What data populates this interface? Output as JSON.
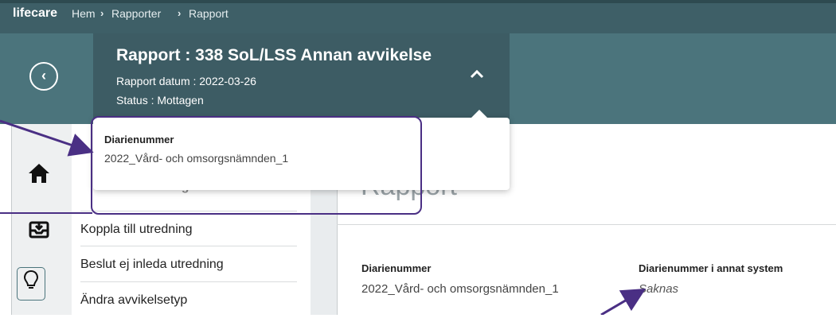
{
  "topbar": {
    "brand": "lifecare",
    "breadcrumb": [
      "Hem",
      "Rapporter",
      "Rapport"
    ],
    "separator": "›"
  },
  "header": {
    "title": "Rapport : 338 SoL/LSS Annan avvikelse",
    "date": "Rapport datum : 2022-03-26",
    "status": "Status : Mottagen",
    "back_icon": "chevron-left-icon",
    "collapse_icon": "chevron-up-icon"
  },
  "popup": {
    "label": "Diarienummer",
    "value": "2022_Vård- och omsorgsnämnden_1"
  },
  "sidebar": {
    "icons": [
      "home-icon",
      "inbox-icon",
      "lightbulb-icon"
    ]
  },
  "menu": {
    "items": [
      "Inled utredning",
      "Koppla till utredning",
      "Beslut ej inleda utredning",
      "Ändra avvikelsetyp"
    ]
  },
  "main": {
    "page_title": "Rapport",
    "fields": [
      {
        "label": "Diarienummer",
        "value": "2022_Vård- och omsorgsnämnden_1"
      },
      {
        "label": "Diarienummer i annat system",
        "value": "Saknas"
      }
    ]
  },
  "colors": {
    "topbar": "#3e5f67",
    "header": "#4b747c",
    "card": "#3d5c64",
    "annotation": "#4a2f84"
  }
}
